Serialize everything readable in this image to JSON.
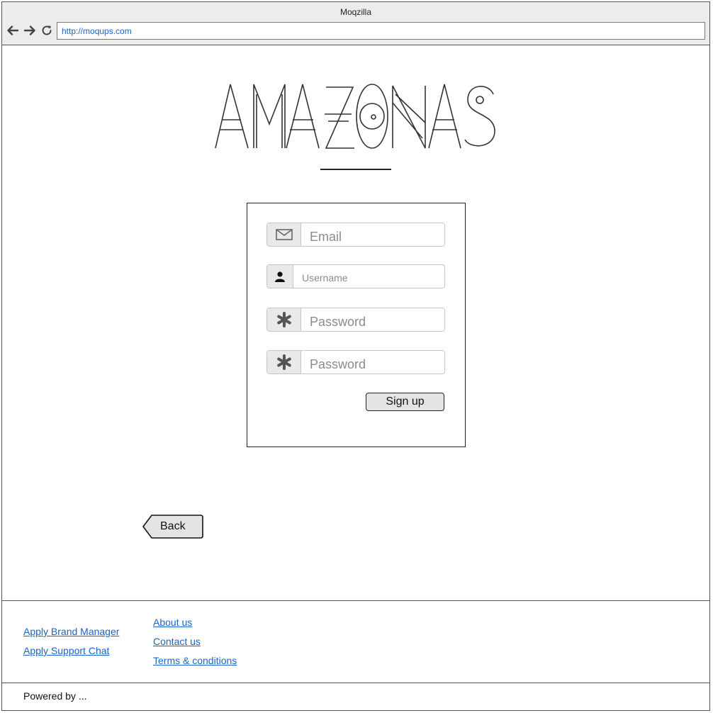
{
  "browser": {
    "window_title": "Moqzilla",
    "url": "http://moqups.com",
    "back_icon": "arrow-left",
    "forward_icon": "arrow-right",
    "reload_icon": "reload"
  },
  "logo": {
    "text": "AMAZONAS"
  },
  "signup_form": {
    "email": {
      "icon": "envelope-icon",
      "placeholder": "Email",
      "value": ""
    },
    "username": {
      "icon": "user-icon",
      "placeholder": "Username",
      "value": ""
    },
    "password": {
      "icon": "asterisk-icon",
      "placeholder": "Password",
      "value": ""
    },
    "password_confirm": {
      "icon": "asterisk-icon",
      "placeholder": "Password",
      "value": ""
    },
    "submit_label": "Sign up"
  },
  "back_button": {
    "label": "Back"
  },
  "footer": {
    "left_links": [
      "Apply Brand Manager",
      "Apply Support Chat"
    ],
    "right_links": [
      "About us",
      "Contact us",
      "Terms & conditions"
    ],
    "powered_by": "Powered by ..."
  },
  "colors": {
    "link": "#1a63c7",
    "chrome": "#ececec",
    "addon": "#e9e9e9",
    "button": "#e4e4e4"
  }
}
